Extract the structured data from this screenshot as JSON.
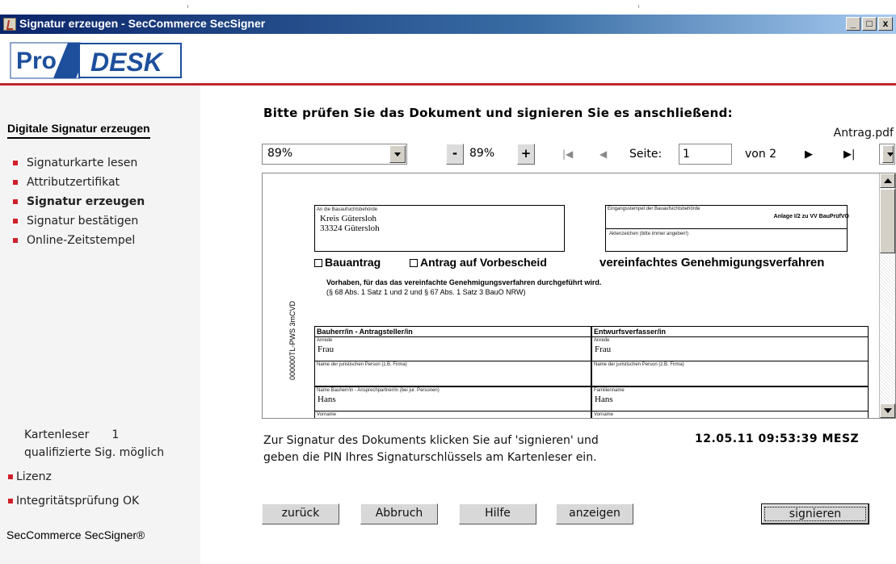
{
  "window": {
    "title": "Signatur erzeugen - SecCommerce SecSigner",
    "controls": [
      "_",
      "□",
      "x"
    ]
  },
  "logo": {
    "part1": "Pro",
    "part2": "DESK"
  },
  "sidebar": {
    "heading": "Digitale Signatur erzeugen",
    "items": [
      {
        "label": "Signaturkarte lesen",
        "active": false
      },
      {
        "label": "Attributzertifikat",
        "active": false
      },
      {
        "label": "Signatur erzeugen",
        "active": true
      },
      {
        "label": "Signatur bestätigen",
        "active": false
      },
      {
        "label": "Online-Zeitstempel",
        "active": false
      }
    ],
    "reader_label": "Kartenleser",
    "reader_count": "1",
    "reader_status": "qualifizierte Sig. möglich",
    "links": [
      "Lizenz",
      "Integritätsprüfung OK"
    ],
    "brand": "SecCommerce SecSigner®"
  },
  "main": {
    "instruction": "Bitte prüfen Sie das Dokument und signieren Sie es anschließend:",
    "filename": "Antrag.pdf"
  },
  "toolbar": {
    "zoom_select": "89%",
    "minus": "-",
    "zoom_value": "89%",
    "plus": "+",
    "page_label": "Seite:",
    "page_value": "1",
    "page_of": "von 2",
    "small_select": "."
  },
  "document": {
    "anlage": "Anlage I/2 zu VV BauPrüfVO",
    "addr_label": "An die Bauaufsichtsbehörde",
    "addr_line1": "Kreis Gütersloh",
    "addr_line2": "33324 Gütersloh",
    "stamp_label": "Eingangsstempel der Bauaufsichtsbehörde",
    "az_label": "Aktenzeichen (bitte immer angeben!)",
    "opt1": "Bauantrag",
    "opt2": "Antrag auf Vorbescheid",
    "procedure": "vereinfachtes Genehmigungsverfahren",
    "vorhaben": "Vorhaben, für das das vereinfachte Genehmigungsverfahren durchgeführt wird.",
    "paragraph": "(§ 68 Abs. 1 Satz 1 und 2 und § 67 Abs. 1 Satz 3 BauO NRW)",
    "sidecode": "000000TL-PWS 3mCVD",
    "left_col": {
      "header": "Bauherr/in - Antragsteller/in",
      "anrede_label": "Anrede",
      "anrede": "Frau",
      "firma_label": "Name der juristischen Person (z.B. Firma)",
      "name_label": "Name Bauherr/in - Ansprechpartner/in (bei jur. Personen)",
      "name": "Hans",
      "vorname_label": "Vorname"
    },
    "right_col": {
      "header": "Entwurfsverfasser/in",
      "anrede_label": "Anrede",
      "anrede": "Frau",
      "firma_label": "Name der juristischen Person (z.B. Firma)",
      "name_label": "Familienname",
      "name": "Hans",
      "vorname_label": "Vorname"
    }
  },
  "footer": {
    "hint_line1": "Zur Signatur des Dokuments klicken Sie auf 'signieren' und",
    "hint_line2": "geben die PIN Ihres Signaturschlüssels am Kartenleser ein.",
    "datetime": "12.05.11 09:53:39 MESZ",
    "buttons": {
      "back": "zurück",
      "cancel": "Abbruch",
      "help": "Hilfe",
      "show": "anzeigen",
      "sign": "signieren"
    }
  },
  "colors": {
    "accent_red": "#c0262c",
    "bullet_red": "#d0202a",
    "logo_blue": "#1d4f9c"
  }
}
